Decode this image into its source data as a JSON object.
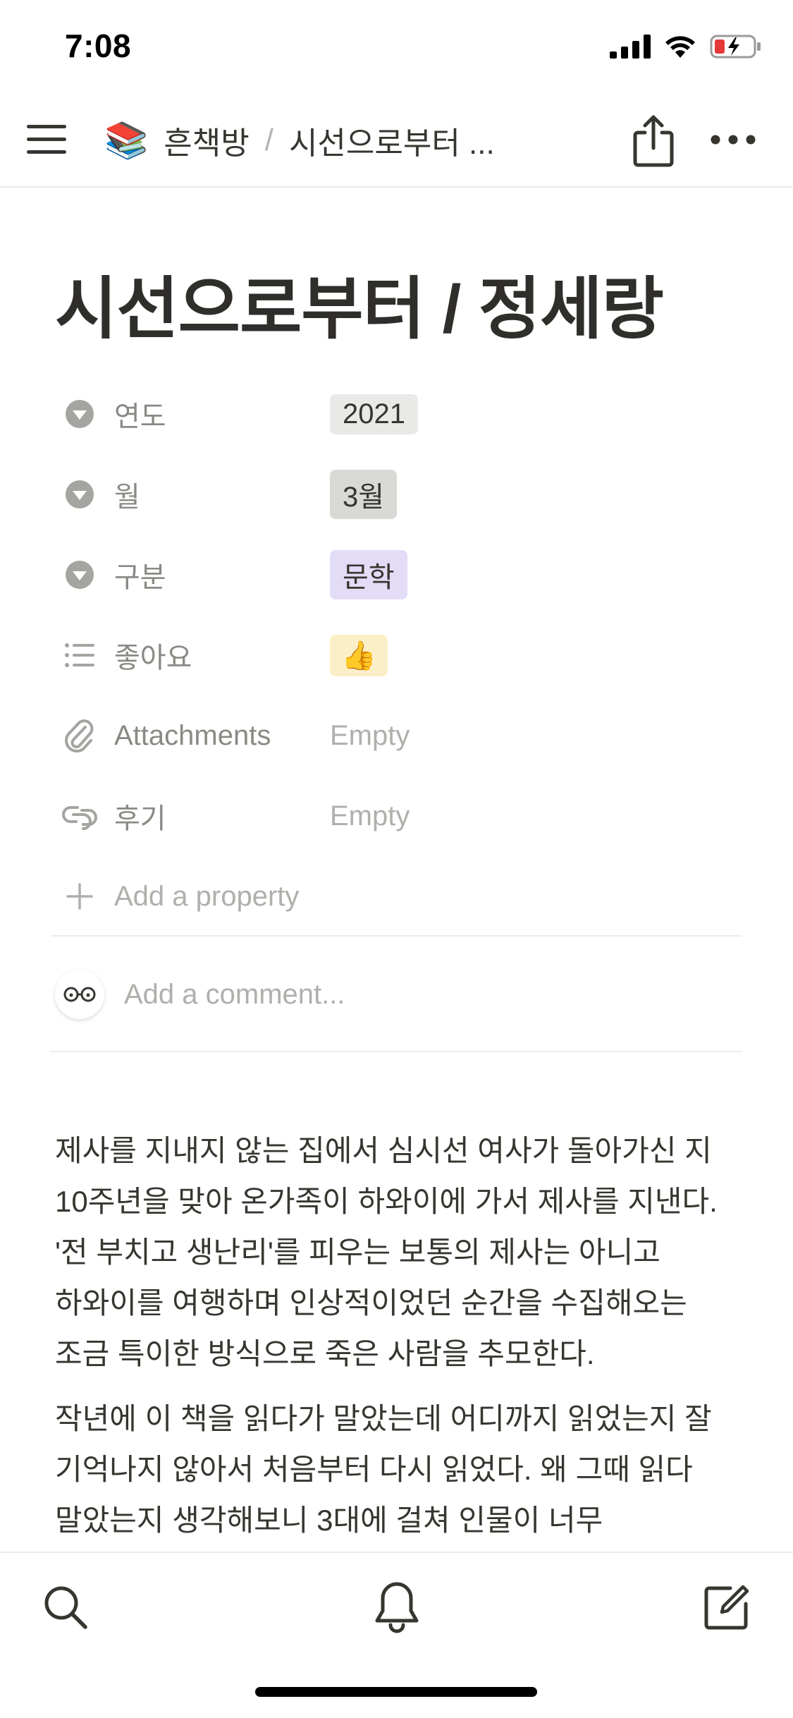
{
  "status_bar": {
    "time": "7:08"
  },
  "nav": {
    "breadcrumb_emoji": "📚",
    "breadcrumb_root": "흔책방",
    "breadcrumb_separator": "/",
    "breadcrumb_current": "시선으로부터 ..."
  },
  "page": {
    "title": "시선으로부터 / 정세랑"
  },
  "properties": [
    {
      "name": "연도",
      "value": "2021",
      "icon": "select-icon"
    },
    {
      "name": "월",
      "value": "3월",
      "icon": "select-icon"
    },
    {
      "name": "구분",
      "value": "문학",
      "icon": "select-icon"
    },
    {
      "name": "좋아요",
      "value": "👍",
      "icon": "list-icon"
    },
    {
      "name": "Attachments",
      "value": "Empty",
      "icon": "paperclip-icon"
    },
    {
      "name": "후기",
      "value": "Empty",
      "icon": "relation-icon"
    }
  ],
  "add_property_label": "Add a property",
  "comment": {
    "placeholder": "Add a comment..."
  },
  "body": [
    "제사를 지내지 않는 집에서 심시선 여사가 돌아가신 지 10주년을 맞아 온가족이 하와이에 가서 제사를 지낸다. '전 부치고 생난리'를 피우는 보통의 제사는 아니고 하와이를 여행하며 인상적이었던 순간을 수집해오는 조금 특이한 방식으로 죽은 사람을 추모한다.",
    "작년에 이 책을 읽다가 말았는데 어디까지 읽었는지 잘 기억나지 않아서 처음부터 다시 읽었다. 왜 그때 읽다 말았는지 생각해보니 3대에 걸쳐 인물이 너무"
  ],
  "colors": {
    "tag_gray": "#e9e9e7",
    "tag_purple": "#e3dcf7",
    "tag_yellow": "#fbefc7",
    "battery_low": "#e5383b"
  }
}
